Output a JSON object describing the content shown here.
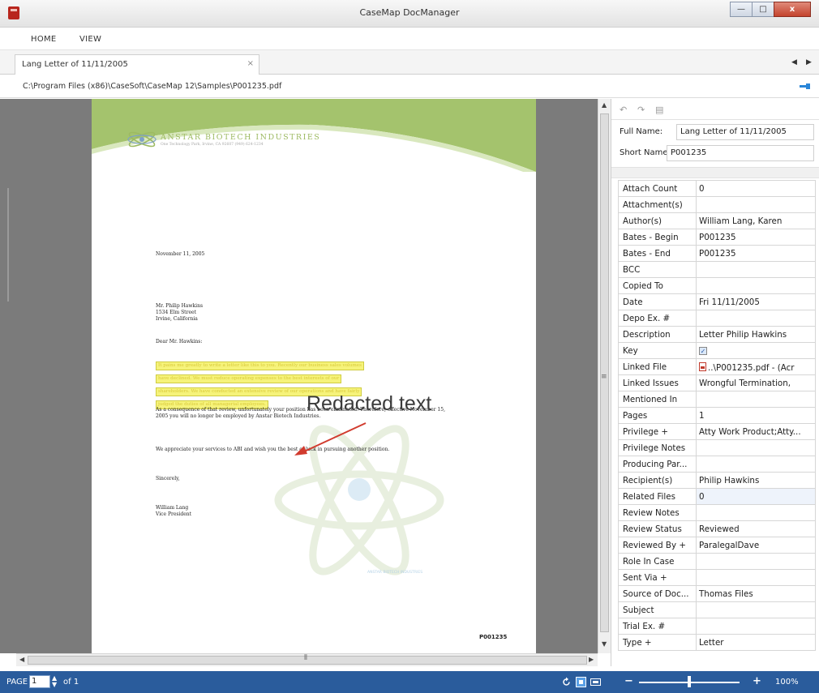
{
  "window": {
    "title": "CaseMap DocManager",
    "min_icon": "minimize-icon",
    "max_icon": "maximize-icon",
    "close_label": "x"
  },
  "menu": {
    "home": "HOME",
    "view": "VIEW"
  },
  "doc_tab": {
    "label": "Lang Letter of 11/11/2005",
    "close": "×"
  },
  "tab_nav": {
    "prev": "◀",
    "next": "▶"
  },
  "path": {
    "text": "C:\\Program Files (x86)\\CaseSoft\\CaseMap 12\\Samples\\P001235.pdf"
  },
  "document": {
    "company_name": "ANSTAR BIOTECH INDUSTRIES",
    "company_address": "One Technology Park, Irvine, CA 92607 (949) 624-1234",
    "date": "November 11, 2005",
    "addressee": [
      "Mr. Philip Hawkins",
      "1534 Elm Street",
      "Irvine, California"
    ],
    "salutation": "Dear Mr. Hawkins:",
    "redacted_lines": [
      "It pains me greatly to write a letter like this to you. Recently our business sales volumes",
      "have declined. We must reduce operating expenses to the best interests of our",
      "shareholders. We have conducted an extensive review of our operations and have fairly",
      "judged the duties of all managerial employees."
    ],
    "paragraph_1": "As a consequence of that review, unfortunately your position has been eliminated. Therefore, effective November 15, 2005 you will no longer be employed by Anstar Biotech Industries.",
    "paragraph_2": "We appreciate your services to ABI and wish you the best of luck in pursuing another position.",
    "closing": "Sincerely,",
    "signature": [
      "William Lang",
      "Vice President"
    ],
    "bates": "P001235",
    "watermark_text": "ANSTAR BIOTECH INDUSTRIES"
  },
  "annotation": {
    "label": "Redacted text",
    "arrow_color": "#d13b2e"
  },
  "scroll": {
    "up": "▲",
    "down": "▼",
    "left": "◀",
    "right": "▶",
    "grip_v": "≡",
    "grip_h": "⦀"
  },
  "properties": {
    "toolbar_icons": [
      "undo-icon",
      "redo-icon",
      "print-icon"
    ],
    "full_name_label": "Full Name:",
    "full_name_value": "Lang Letter of 11/11/2005",
    "short_name_label": "Short Name:",
    "short_name_value": "P001235",
    "fields": [
      {
        "key": "Attach Count",
        "value": "0"
      },
      {
        "key": "Attachment(s)",
        "value": ""
      },
      {
        "key": "Author(s)",
        "value": "William Lang, Karen"
      },
      {
        "key": "Bates - Begin",
        "value": "P001235"
      },
      {
        "key": "Bates - End",
        "value": "P001235"
      },
      {
        "key": "BCC",
        "value": ""
      },
      {
        "key": "Copied To",
        "value": ""
      },
      {
        "key": "Date",
        "value": "Fri 11/11/2005"
      },
      {
        "key": "Depo Ex. #",
        "value": ""
      },
      {
        "key": "Description",
        "value": "Letter Philip Hawkins"
      },
      {
        "key": "Key",
        "value": "",
        "checkbox": true
      },
      {
        "key": "Linked File",
        "value": "..\\P001235.pdf - (Acr",
        "pdf_icon": true
      },
      {
        "key": "Linked Issues",
        "value": "Wrongful Termination,"
      },
      {
        "key": "Mentioned In",
        "value": ""
      },
      {
        "key": "Pages",
        "value": "1"
      },
      {
        "key": "Privilege +",
        "value": "Atty Work Product;Atty..."
      },
      {
        "key": "Privilege Notes",
        "value": ""
      },
      {
        "key": "Producing Par...",
        "value": ""
      },
      {
        "key": "Recipient(s)",
        "value": "Philip Hawkins"
      },
      {
        "key": "Related Files",
        "value": "0",
        "selected": true
      },
      {
        "key": "Review Notes",
        "value": ""
      },
      {
        "key": "Review Status",
        "value": "Reviewed"
      },
      {
        "key": "Reviewed By +",
        "value": "ParalegalDave"
      },
      {
        "key": "Role In Case",
        "value": ""
      },
      {
        "key": "Sent Via +",
        "value": ""
      },
      {
        "key": "Source of Doc...",
        "value": "Thomas Files"
      },
      {
        "key": "Subject",
        "value": ""
      },
      {
        "key": "Trial Ex. #",
        "value": ""
      },
      {
        "key": "Type +",
        "value": "Letter"
      }
    ]
  },
  "status": {
    "page_label": "PAGE",
    "page_value": "1",
    "of_label": "of 1",
    "zoom_minus": "−",
    "zoom_plus": "+",
    "zoom_percent": "100%",
    "zoom_level": 0.5,
    "colors": {
      "statusbar": "#2a5c9c"
    }
  }
}
